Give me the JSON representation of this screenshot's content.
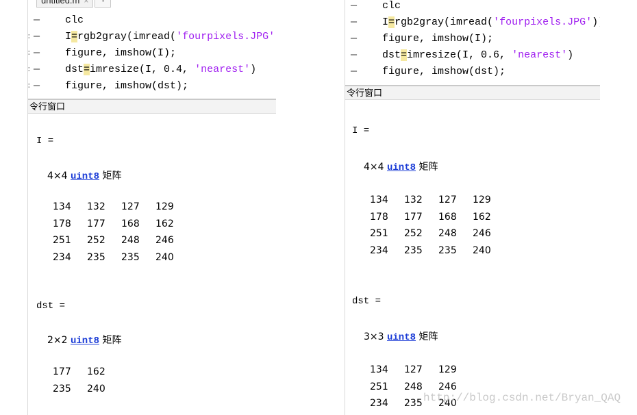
{
  "left": {
    "tab": {
      "label": "untitled.m",
      "close": "×",
      "add": "+"
    },
    "code": [
      {
        "pre": "clc"
      },
      {
        "pre": "I",
        "op": "=",
        "fn": "rgb2gray(imread(",
        "str": "'fourpixels.JPG'",
        "post": "))"
      },
      {
        "pre": "figure, imshow(I);"
      },
      {
        "pre": "dst",
        "op": "=",
        "fn": "imresize(I, 0.4, ",
        "str": "'nearest'",
        "post": ")"
      },
      {
        "pre": "figure, imshow(dst);"
      }
    ],
    "window_title": "令行窗口",
    "var1": "I =",
    "dim1": "4×4",
    "type1": "uint8",
    "mat_label": "矩阵",
    "matrix1": [
      [
        "134",
        "132",
        "127",
        "129"
      ],
      [
        "178",
        "177",
        "168",
        "162"
      ],
      [
        "251",
        "252",
        "248",
        "246"
      ],
      [
        "234",
        "235",
        "235",
        "240"
      ]
    ],
    "var2": "dst =",
    "dim2": "2×2",
    "type2": "uint8",
    "matrix2": [
      [
        "177",
        "162"
      ],
      [
        "235",
        "240"
      ]
    ]
  },
  "right": {
    "code": [
      {
        "pre": "clc"
      },
      {
        "pre": "I",
        "op": "=",
        "fn": "rgb2gray(imread(",
        "str": "'fourpixels.JPG'",
        "post": "))"
      },
      {
        "pre": "figure, imshow(I);"
      },
      {
        "pre": "dst",
        "op": "=",
        "fn": "imresize(I, 0.6, ",
        "str": "'nearest'",
        "post": ")"
      },
      {
        "pre": "figure, imshow(dst);"
      }
    ],
    "window_title": "令行窗口",
    "var1": "I =",
    "dim1": "4×4",
    "type1": "uint8",
    "mat_label": "矩阵",
    "matrix1": [
      [
        "134",
        "132",
        "127",
        "129"
      ],
      [
        "178",
        "177",
        "168",
        "162"
      ],
      [
        "251",
        "252",
        "248",
        "246"
      ],
      [
        "234",
        "235",
        "235",
        "240"
      ]
    ],
    "var2": "dst =",
    "dim2": "3×3",
    "type2": "uint8",
    "matrix2": [
      [
        "134",
        "127",
        "129"
      ],
      [
        "251",
        "248",
        "246"
      ],
      [
        "234",
        "235",
        "240"
      ]
    ]
  },
  "watermark": "http://blog.csdn.net/Bryan_QAQ"
}
